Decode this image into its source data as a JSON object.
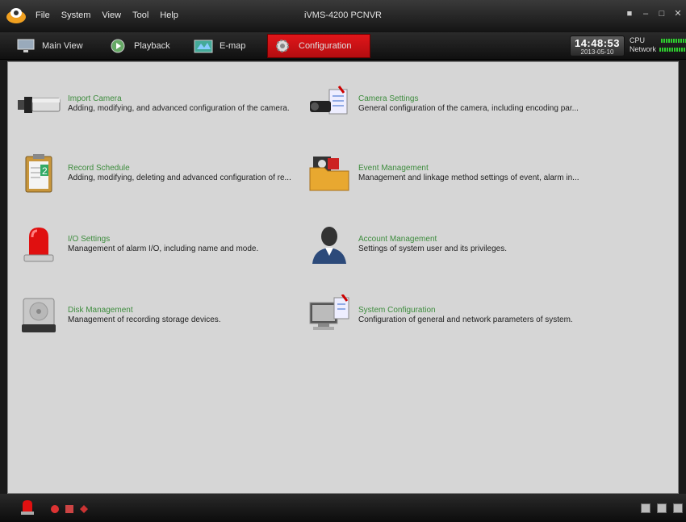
{
  "window": {
    "title": "iVMS-4200 PCNVR",
    "menu": [
      "File",
      "System",
      "View",
      "Tool",
      "Help"
    ]
  },
  "tabs": [
    {
      "label": "Main View",
      "icon": "monitor-icon"
    },
    {
      "label": "Playback",
      "icon": "playback-icon"
    },
    {
      "label": "E-map",
      "icon": "map-icon"
    },
    {
      "label": "Configuration",
      "icon": "gear-icon",
      "active": true
    }
  ],
  "status": {
    "time": "14:48:53",
    "date": "2013-05-10",
    "cpu_label": "CPU",
    "network_label": "Network"
  },
  "items": [
    {
      "title": "Import Camera",
      "desc": "Adding, modifying, and advanced configuration of the camera."
    },
    {
      "title": "Camera Settings",
      "desc": "General configuration of the camera, including encoding par..."
    },
    {
      "title": "Record Schedule",
      "desc": "Adding, modifying, deleting and advanced configuration of re..."
    },
    {
      "title": "Event Management",
      "desc": "Management and linkage method settings of event, alarm in..."
    },
    {
      "title": "I/O Settings",
      "desc": "Management of alarm I/O, including name and mode."
    },
    {
      "title": "Account Management",
      "desc": "Settings of system user and its privileges."
    },
    {
      "title": "Disk Management",
      "desc": "Management of recording storage devices."
    },
    {
      "title": "System Configuration",
      "desc": "Configuration of general and network parameters of system."
    }
  ],
  "colors": {
    "accent": "#d01418",
    "title_green": "#3d8c3d",
    "panel_bg": "#d6d6d6"
  }
}
